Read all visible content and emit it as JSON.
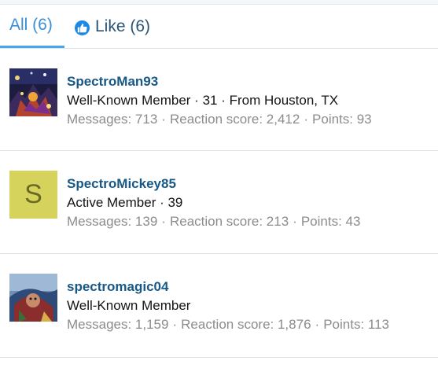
{
  "tabs": [
    {
      "label": "All (6)"
    },
    {
      "label": "Like (6)"
    }
  ],
  "members": [
    {
      "username": "SpectroMan93",
      "title": "Well-Known Member · 31 · From Houston, TX",
      "messages": "Messages: 713",
      "reaction": "Reaction score: 2,412",
      "points": "Points: 93"
    },
    {
      "username": "SpectroMickey85",
      "title": "Active Member · 39",
      "avatar_letter": "S",
      "messages": "Messages: 139",
      "reaction": "Reaction score: 213",
      "points": "Points: 43"
    },
    {
      "username": "spectromagic04",
      "title": "Well-Known Member",
      "messages": "Messages: 1,159",
      "reaction": "Reaction score: 1,876",
      "points": "Points: 113"
    }
  ],
  "separator": "·",
  "colors": {
    "accent": "#47a7eb",
    "username": "#185886",
    "muted": "#8c8c8c",
    "letter_avatar_bg": "#d5d35c"
  }
}
